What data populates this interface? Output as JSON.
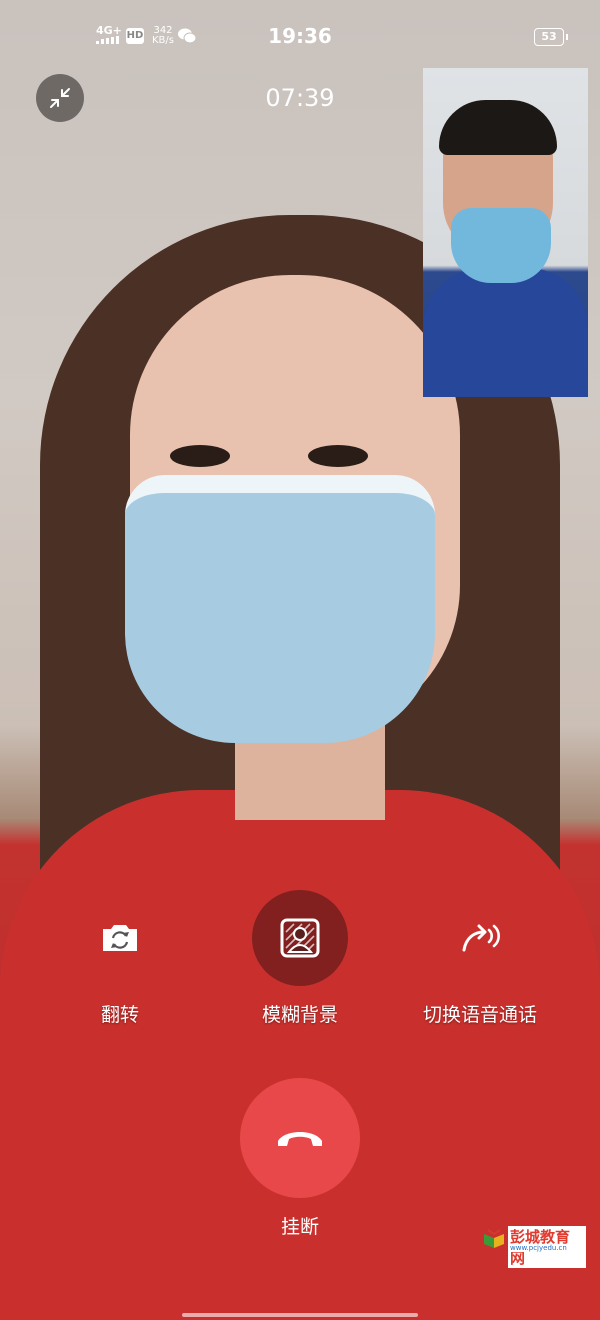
{
  "status_bar": {
    "network": "4G+",
    "hd": "HD",
    "speed_value": "342",
    "speed_unit": "KB/s",
    "time": "19:36",
    "battery": "53"
  },
  "call": {
    "duration": "07:39"
  },
  "controls": {
    "flip_label": "翻转",
    "blur_label": "模糊背景",
    "voice_label": "切换语音通话",
    "hangup_label": "挂断"
  },
  "watermark": {
    "name": "彭城教育网",
    "url": "www.pcjyedu.cn"
  },
  "icons": {
    "minimize": "minimize-icon",
    "flip_camera": "flip-camera-icon",
    "blur_background": "blur-background-icon",
    "switch_voice": "switch-voice-icon",
    "hangup": "phone-hangup-icon"
  },
  "colors": {
    "hangup": "#e8484a"
  }
}
